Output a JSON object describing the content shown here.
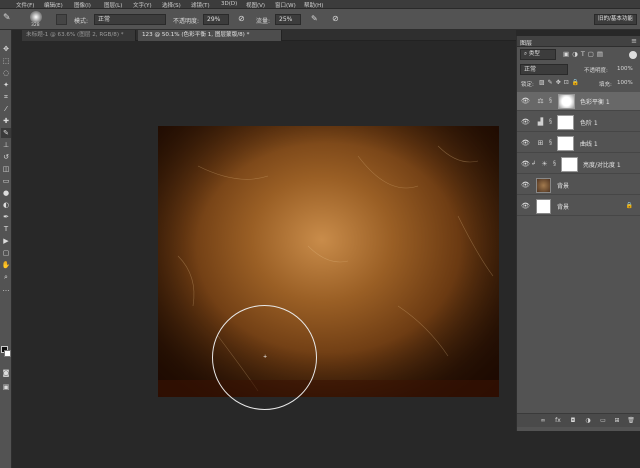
{
  "menu": [
    "文件(F)",
    "编辑(E)",
    "图像(I)",
    "图层(L)",
    "文字(Y)",
    "选择(S)",
    "滤镜(T)",
    "3D(D)",
    "视图(V)",
    "窗口(W)",
    "帮助(H)"
  ],
  "options_bar": {
    "brush_size": "328",
    "mode_label": "模式:",
    "mode_value": "正常",
    "opacity_label": "不透明度:",
    "opacity_value": "29%",
    "flow_label": "流量:",
    "flow_value": "25%",
    "workspace_label": "旧的/基本功能"
  },
  "tabs": [
    {
      "label": "未标题-1 @ 63.6% (图层 2, RGB/8) *",
      "active": false
    },
    {
      "label": "123 @ 50.1% (色彩平衡 1, 图层蒙版/8) *",
      "active": true
    }
  ],
  "layers_panel": {
    "title": "图层",
    "filter_label": "类型",
    "blend_mode": "正常",
    "opacity_label": "不透明度:",
    "opacity_value": "100%",
    "lock_label": "锁定:",
    "fill_label": "填充:",
    "fill_value": "100%",
    "layers": [
      {
        "name": "色彩平衡 1",
        "icon": "balance-icon",
        "thumb": "mask",
        "selected": true
      },
      {
        "name": "色阶 1",
        "icon": "levels-icon",
        "thumb": "mask",
        "selected": false
      },
      {
        "name": "曲线 1",
        "icon": "curves-icon",
        "thumb": "mask",
        "selected": false
      },
      {
        "name": "亮度/对比度 1",
        "icon": "brightness-icon",
        "thumb": "mask",
        "selected": false
      },
      {
        "name": "背景",
        "icon": "",
        "thumb": "image",
        "selected": false
      },
      {
        "name": "背景",
        "icon": "",
        "thumb": "white",
        "selected": false
      }
    ]
  },
  "colors": {
    "panel": "#535353",
    "workspace": "#282828",
    "accent": "#686868"
  }
}
